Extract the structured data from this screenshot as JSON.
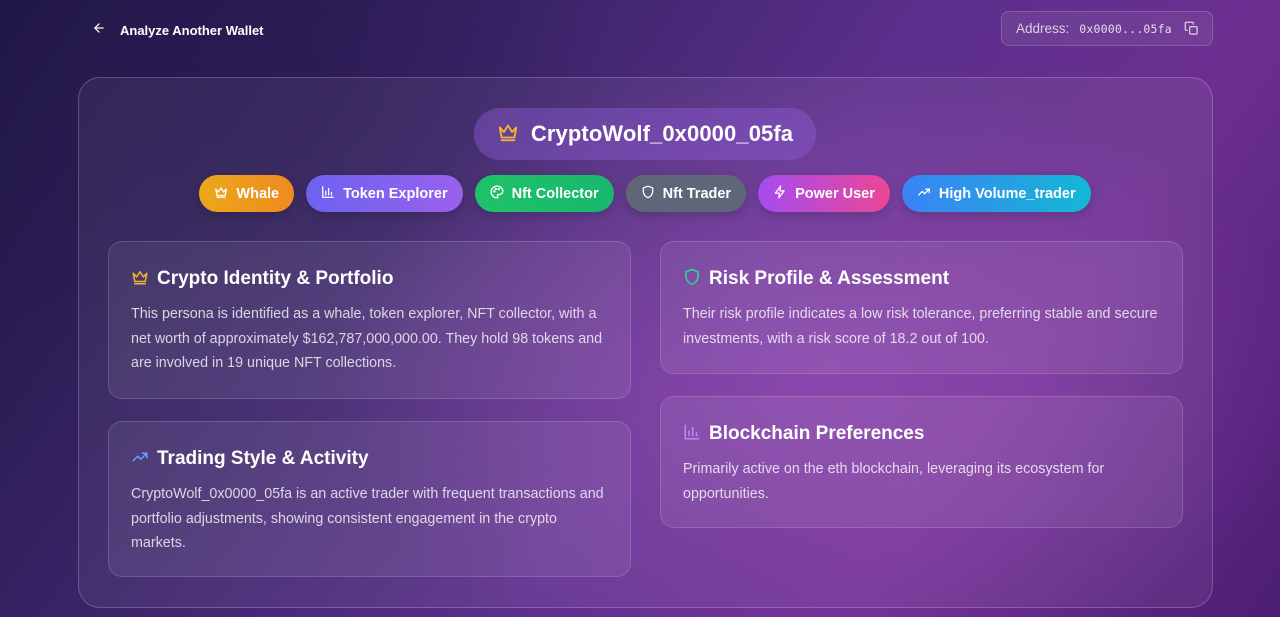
{
  "nav": {
    "back_label": "Analyze Another Wallet"
  },
  "address": {
    "label": "Address:",
    "value": "0x0000...05fa"
  },
  "persona": {
    "name": "CryptoWolf_0x0000_05fa"
  },
  "tags": [
    {
      "label": "Whale",
      "icon": "crown-icon"
    },
    {
      "label": "Token Explorer",
      "icon": "bar-chart-icon"
    },
    {
      "label": "Nft Collector",
      "icon": "palette-icon"
    },
    {
      "label": "Nft Trader",
      "icon": "shield-icon"
    },
    {
      "label": "Power User",
      "icon": "lightning-icon"
    },
    {
      "label": "High Volume_trader",
      "icon": "trending-up-icon"
    }
  ],
  "cards": {
    "identity": {
      "title": "Crypto Identity & Portfolio",
      "body": "This persona is identified as a whale, token explorer, NFT collector, with a net worth of approximately $162,787,000,000.00. They hold 98 tokens and are involved in 19 unique NFT collections.",
      "icon": "crown-icon"
    },
    "trading": {
      "title": "Trading Style & Activity",
      "body": "CryptoWolf_0x0000_05fa is an active trader with frequent transactions and portfolio adjustments, showing consistent engagement in the crypto markets.",
      "icon": "trending-up-icon"
    },
    "risk": {
      "title": "Risk Profile & Assessment",
      "body": "Their risk profile indicates a low risk tolerance, preferring stable and secure investments, with a risk score of 18.2 out of 100.",
      "icon": "shield-icon"
    },
    "blockchain": {
      "title": "Blockchain Preferences",
      "body": "Primarily active on the eth blockchain, leveraging its ecosystem for opportunities.",
      "icon": "bar-chart-icon"
    }
  },
  "colors": {
    "accent_gold": "#f4b62a",
    "accent_green": "#34d399",
    "accent_blue": "#60a5fa",
    "accent_violet": "#c084fc"
  }
}
